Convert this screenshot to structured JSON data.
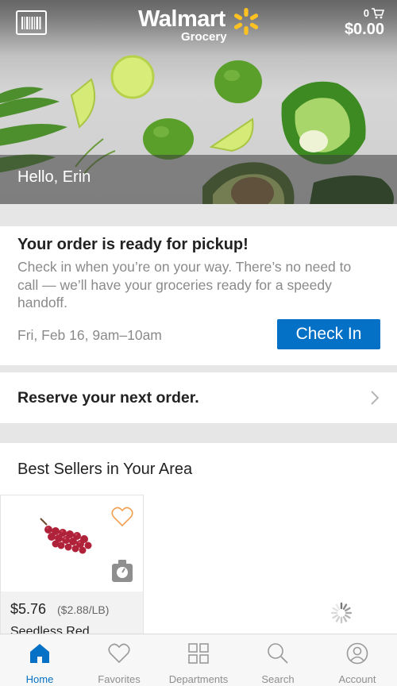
{
  "header": {
    "brand_name": "Walmart",
    "brand_sub": "Grocery",
    "cart_count": "0",
    "cart_total": "$0.00",
    "greeting": "Hello, Erin"
  },
  "order": {
    "title": "Your order is ready for pickup!",
    "description": "Check in when you’re on your way. There’s no need to call — we’ll have your groceries ready for a speedy handoff.",
    "time": "Fri, Feb 16, 9am–10am",
    "checkin_label": "Check In"
  },
  "reserve": {
    "label": "Reserve your next order."
  },
  "best_sellers": {
    "title": "Best Sellers in Your Area",
    "products": [
      {
        "price": "$5.76",
        "unit_price": "($2.88/LB)",
        "name": "Seedless Red"
      }
    ]
  },
  "tabs": [
    {
      "label": "Home",
      "icon": "home-icon",
      "active": true
    },
    {
      "label": "Favorites",
      "icon": "heart-icon",
      "active": false
    },
    {
      "label": "Departments",
      "icon": "grid-icon",
      "active": false
    },
    {
      "label": "Search",
      "icon": "search-icon",
      "active": false
    },
    {
      "label": "Account",
      "icon": "account-icon",
      "active": false
    }
  ],
  "colors": {
    "accent_blue": "#0571c6",
    "spark_yellow": "#ffc220",
    "favorite_orange": "#f0a050"
  }
}
